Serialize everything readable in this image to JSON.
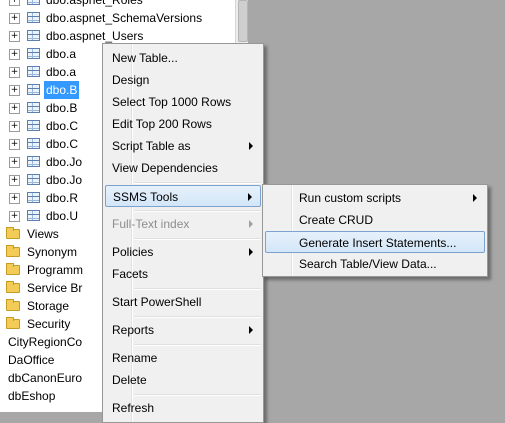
{
  "tree": {
    "tables": [
      {
        "label": "dbo.aspnet_Roles"
      },
      {
        "label": "dbo.aspnet_SchemaVersions"
      },
      {
        "label": "dbo.aspnet_Users"
      },
      {
        "label": "dbo.a"
      },
      {
        "label": "dbo.a"
      },
      {
        "label": "dbo.B"
      },
      {
        "label": "dbo.B"
      },
      {
        "label": "dbo.C"
      },
      {
        "label": "dbo.C"
      },
      {
        "label": "dbo.Jo"
      },
      {
        "label": "dbo.Jo"
      },
      {
        "label": "dbo.R"
      },
      {
        "label": "dbo.U"
      }
    ],
    "folders": [
      {
        "label": "Views"
      },
      {
        "label": "Synonym"
      },
      {
        "label": "Programm"
      },
      {
        "label": "Service Br"
      },
      {
        "label": "Storage"
      },
      {
        "label": "Security"
      }
    ],
    "databases": [
      {
        "label": "CityRegionCo"
      },
      {
        "label": "DaOffice"
      },
      {
        "label": "dbCanonEuro"
      },
      {
        "label": "dbEshop"
      }
    ]
  },
  "context_menu": {
    "items": [
      {
        "label": "New Table..."
      },
      {
        "label": "Design"
      },
      {
        "label": "Select Top 1000 Rows"
      },
      {
        "label": "Edit Top 200 Rows"
      },
      {
        "label": "Script Table as"
      },
      {
        "label": "View Dependencies"
      },
      {
        "label": "SSMS Tools"
      },
      {
        "label": "Full-Text index"
      },
      {
        "label": "Policies"
      },
      {
        "label": "Facets"
      },
      {
        "label": "Start PowerShell"
      },
      {
        "label": "Reports"
      },
      {
        "label": "Rename"
      },
      {
        "label": "Delete"
      },
      {
        "label": "Refresh"
      }
    ]
  },
  "ssms_submenu": {
    "items": [
      {
        "label": "Run custom scripts"
      },
      {
        "label": "Create CRUD"
      },
      {
        "label": "Generate Insert Statements..."
      },
      {
        "label": "Search Table/View Data..."
      }
    ]
  }
}
